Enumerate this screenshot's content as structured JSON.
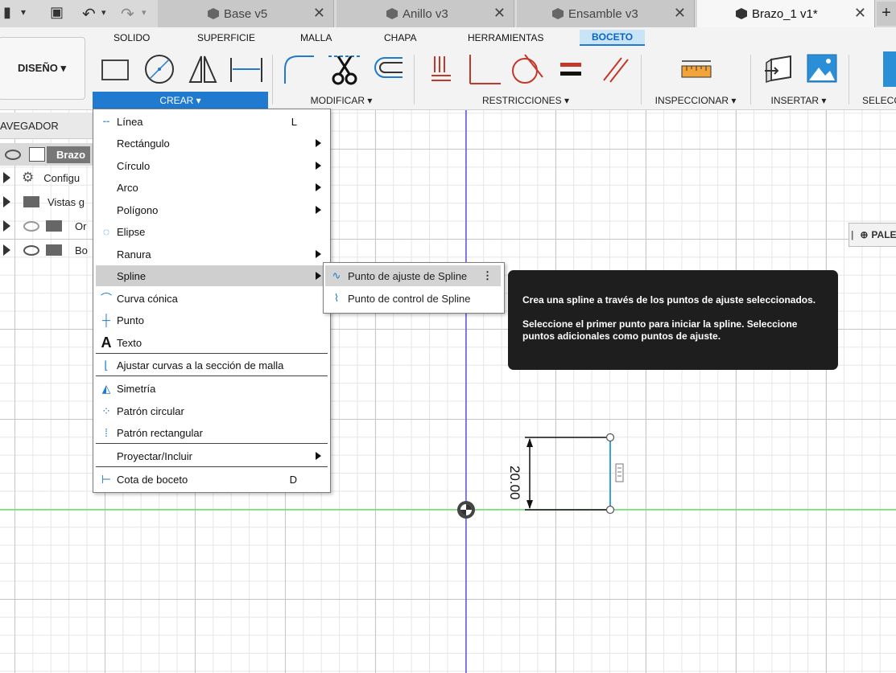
{
  "tabs": [
    {
      "title": "Base v5",
      "active": false
    },
    {
      "title": "Anillo v3",
      "active": false
    },
    {
      "title": "Ensamble v3",
      "active": false
    },
    {
      "title": "Brazo_1 v1*",
      "active": true
    }
  ],
  "ribbon": {
    "tabs": [
      "SOLIDO",
      "SUPERFICIE",
      "MALLA",
      "CHAPA",
      "HERRAMIENTAS",
      "BOCETO"
    ],
    "active_tab": "BOCETO",
    "workspace": "DISEÑO ▾",
    "groups": [
      "CREAR ▾",
      "MODIFICAR ▾",
      "RESTRICCIONES ▾",
      "INSPECCIONAR ▾",
      "INSERTAR ▾",
      "SELECC"
    ]
  },
  "browser": {
    "header": "AVEGADOR",
    "items": [
      "Brazo",
      "Configu",
      "Vistas g",
      "Or",
      "Bo"
    ]
  },
  "menu": {
    "items": [
      {
        "label": "Línea",
        "shortcut": "L",
        "submenu": false,
        "icon": "line-icon"
      },
      {
        "label": "Rectángulo",
        "shortcut": "",
        "submenu": true,
        "icon": ""
      },
      {
        "label": "Círculo",
        "shortcut": "",
        "submenu": true,
        "icon": ""
      },
      {
        "label": "Arco",
        "shortcut": "",
        "submenu": true,
        "icon": ""
      },
      {
        "label": "Polígono",
        "shortcut": "",
        "submenu": true,
        "icon": ""
      },
      {
        "label": "Elipse",
        "shortcut": "",
        "submenu": false,
        "icon": "ellipse-icon"
      },
      {
        "label": "Ranura",
        "shortcut": "",
        "submenu": true,
        "icon": ""
      },
      {
        "label": "Spline",
        "shortcut": "",
        "submenu": true,
        "icon": "",
        "highlighted": true
      },
      {
        "label": "Curva cónica",
        "shortcut": "",
        "submenu": false,
        "icon": "conic-curve-icon"
      },
      {
        "label": "Punto",
        "shortcut": "",
        "submenu": false,
        "icon": "point-icon"
      },
      {
        "label": "Texto",
        "shortcut": "",
        "submenu": false,
        "icon": "text-icon"
      },
      {
        "label": "Ajustar curvas a la sección de malla",
        "shortcut": "",
        "submenu": false,
        "icon": "fit-curves-icon"
      },
      {
        "label": "Simetría",
        "shortcut": "",
        "submenu": false,
        "icon": "mirror-icon"
      },
      {
        "label": "Patrón circular",
        "shortcut": "",
        "submenu": false,
        "icon": "circular-pattern-icon"
      },
      {
        "label": "Patrón rectangular",
        "shortcut": "",
        "submenu": false,
        "icon": "rectangular-pattern-icon"
      },
      {
        "label": "Proyectar/Incluir",
        "shortcut": "",
        "submenu": true,
        "icon": ""
      },
      {
        "label": "Cota de boceto",
        "shortcut": "D",
        "submenu": false,
        "icon": "sketch-dimension-icon"
      }
    ]
  },
  "submenu": {
    "items": [
      {
        "label": "Punto de ajuste de Spline",
        "highlighted": true
      },
      {
        "label": "Punto de control de Spline",
        "highlighted": false
      }
    ]
  },
  "tooltip": {
    "line1": "Crea una spline a través de los puntos de ajuste seleccionados.",
    "line2": "Seleccione el primer punto para iniciar la spline. Seleccione puntos adicionales como puntos de ajuste."
  },
  "palette": {
    "label": "PALE"
  },
  "sketch": {
    "dimension": "20.00"
  },
  "colors": {
    "accent": "#1f7ad0",
    "axis_x": "#6be36b",
    "axis_y": "#3a3ad8",
    "tooltip_bg": "#1e1e1e"
  }
}
